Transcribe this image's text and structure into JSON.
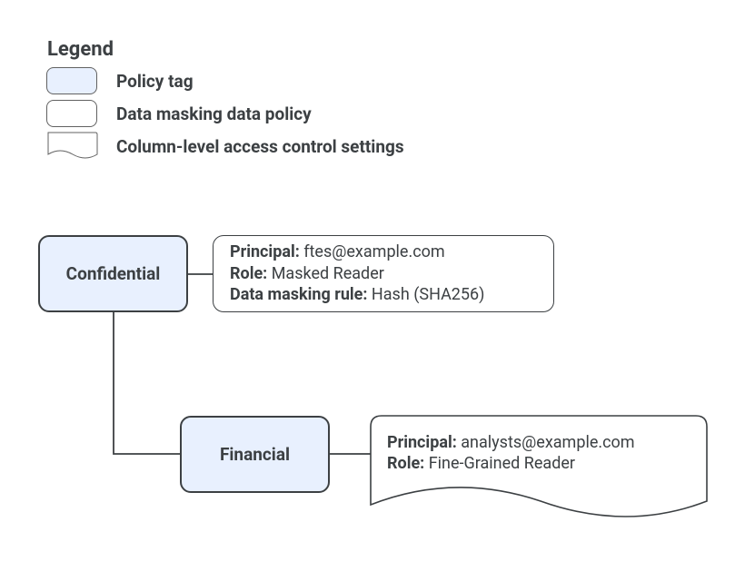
{
  "legend": {
    "title": "Legend",
    "items": [
      {
        "label": "Policy tag"
      },
      {
        "label": "Data masking data policy"
      },
      {
        "label": "Column-level access control settings"
      }
    ]
  },
  "nodes": {
    "confidential": {
      "label": "Confidential"
    },
    "financial": {
      "label": "Financial"
    }
  },
  "policies": {
    "masking_policy": {
      "rows": [
        {
          "key": "Principal:",
          "value": " ftes@example.com"
        },
        {
          "key": "Role:",
          "value": " Masked Reader"
        },
        {
          "key": "Data masking rule:",
          "value": " Hash (SHA256)"
        }
      ]
    },
    "acl_policy": {
      "rows": [
        {
          "key": "Principal:",
          "value": " analysts@example.com"
        },
        {
          "key": "Role:",
          "value": " Fine-Grained Reader"
        }
      ]
    }
  }
}
